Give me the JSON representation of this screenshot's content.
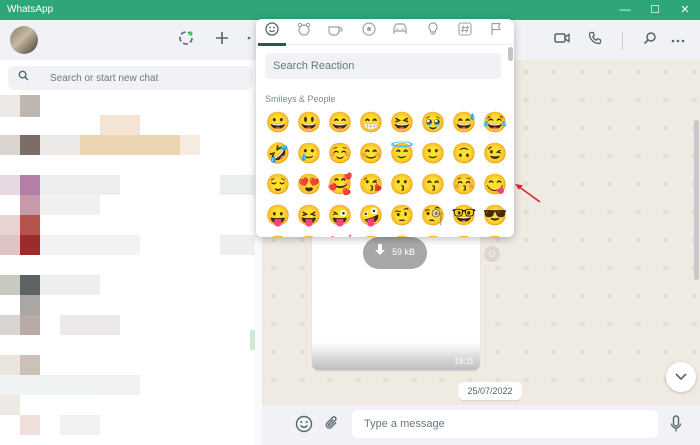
{
  "window": {
    "title": "WhatsApp",
    "controls": {
      "minimize": "—",
      "maximize": "☐",
      "close": "✕"
    }
  },
  "left_pane": {
    "header_icons": [
      "status-icon",
      "new-chat-icon",
      "menu-icon"
    ],
    "search": {
      "placeholder": "Search or start new chat",
      "icon": "search-icon"
    }
  },
  "chat": {
    "header_icons": [
      "video-call-icon",
      "voice-call-icon",
      "search-icon",
      "menu-icon"
    ],
    "media_message": {
      "download_size": "59 kB",
      "time": "19:11"
    },
    "date_separator": "25/07/2022",
    "composer": {
      "placeholder": "Type a message",
      "icons": [
        "emoji-icon",
        "attach-icon",
        "mic-icon"
      ]
    }
  },
  "emoji_popup": {
    "categories": [
      "smileys",
      "animals",
      "food",
      "activity",
      "travel",
      "objects",
      "symbols",
      "flags"
    ],
    "active_category": "smileys",
    "search_placeholder": "Search Reaction",
    "section_title": "Smileys & People",
    "emojis": [
      [
        "😀",
        "😃",
        "😄",
        "😁",
        "😆",
        "🥹",
        "😅",
        "😂"
      ],
      [
        "🤣",
        "🥲",
        "☺️",
        "😊",
        "😇",
        "🙂",
        "🙃",
        "😉"
      ],
      [
        "😌",
        "😍",
        "🥰",
        "😘",
        "😗",
        "😙",
        "😚",
        "😋"
      ],
      [
        "😛",
        "😝",
        "😜",
        "🤪",
        "🤨",
        "🧐",
        "🤓",
        "😎"
      ],
      [
        "🥸",
        "🤩",
        "🥳",
        "😏",
        "😒",
        "😞",
        "😔",
        "😟"
      ]
    ]
  },
  "colors": {
    "titlebar": "#2fa67a",
    "header_bg": "#f0f2f5",
    "chat_bg": "#efeae2",
    "annotation": "#d62a2a"
  }
}
